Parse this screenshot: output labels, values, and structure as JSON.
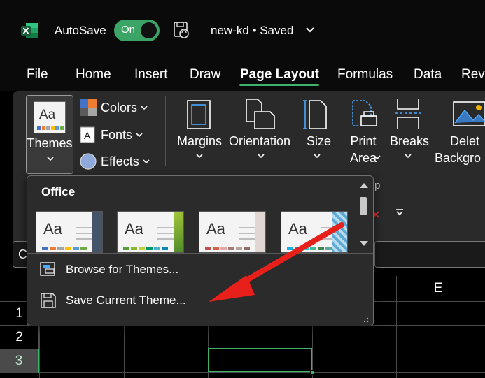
{
  "titlebar": {
    "autosave_label": "AutoSave",
    "toggle_state": "On",
    "document_name": "new-kd • Saved"
  },
  "tabs": [
    {
      "label": "File"
    },
    {
      "label": "Home"
    },
    {
      "label": "Insert"
    },
    {
      "label": "Draw"
    },
    {
      "label": "Page Layout",
      "active": true
    },
    {
      "label": "Formulas"
    },
    {
      "label": "Data"
    },
    {
      "label": "Rev"
    }
  ],
  "ribbon": {
    "themes_label": "Themes",
    "colors_label": "Colors",
    "fonts_label": "Fonts",
    "effects_label": "Effects",
    "margins_label": "Margins",
    "orientation_label": "Orientation",
    "size_label": "Size",
    "print_area_line1": "Print",
    "print_area_line2": "Area",
    "breaks_label": "Breaks",
    "delete_line1": "Delet",
    "delete_line2": "Backgro",
    "group_label_fragment": "p"
  },
  "namebox": {
    "value": "C"
  },
  "dropdown": {
    "heading": "Office",
    "browse_label": "Browse for Themes...",
    "save_label": "Save Current Theme...",
    "tiles": [
      {
        "aa": "Aa",
        "edge_color": "#44546a"
      },
      {
        "aa": "Aa",
        "edge_color": "#70ad47"
      },
      {
        "aa": "Aa",
        "edge_color": "#d9c7c0"
      },
      {
        "aa": "Aa",
        "edge_color": "#5fa8d3"
      }
    ]
  },
  "grid": {
    "column_visible": "E",
    "rows": [
      "1",
      "2",
      "3"
    ],
    "selected_row": "3"
  },
  "colors": {
    "accent_green": "#3fb36b",
    "arrow_red": "#e8201c",
    "ribbon_bg": "#2a2a2a"
  }
}
